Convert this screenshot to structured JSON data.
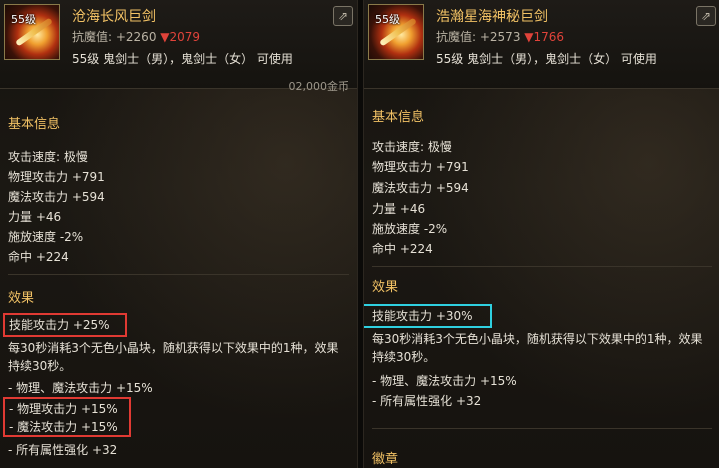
{
  "left_item": {
    "level_badge": "55级",
    "name": "沧海长风巨剑",
    "resist_label": "抗魔值: +2260",
    "resist_delta": "▼2079",
    "classes": "55级 鬼剑士（男），鬼剑士（女） 可使用",
    "price_stub": "02,000金币",
    "basic_info_title": "基本信息",
    "stats": [
      "攻击速度: 极慢",
      "物理攻击力 +791",
      "魔法攻击力 +594",
      "力量 +46",
      "施放速度 -2%",
      "命中 +224"
    ],
    "effects_title": "效果",
    "effect_skill": "技能攻击力 +25%",
    "effect_desc": "每30秒消耗3个无色小晶块，随机获得以下效果中的1种，效果持续30秒。",
    "effect_opt1": "- 物理、魔法攻击力 +15%",
    "effect_opt2": "- 物理攻击力 +15%",
    "effect_opt3": "- 魔法攻击力 +15%",
    "effect_opt4": "- 所有属性强化 +32"
  },
  "right_item": {
    "level_badge": "55级",
    "name": "浩瀚星海神秘巨剑",
    "resist_label": "抗魔值: +2573",
    "resist_delta": "▼1766",
    "classes": "55级 鬼剑士（男），鬼剑士（女） 可使用",
    "basic_info_title": "基本信息",
    "stats": [
      "攻击速度: 极慢",
      "物理攻击力 +791",
      "魔法攻击力 +594",
      "力量 +46",
      "施放速度 -2%",
      "命中 +224"
    ],
    "effects_title": "效果",
    "effect_skill": "技能攻击力 +30%",
    "effect_desc": "每30秒消耗3个无色小晶块，随机获得以下效果中的1种，效果持续30秒。",
    "effect_opt1": "- 物理、魔法攻击力 +15%",
    "effect_opt2": "- 所有属性强化 +32",
    "emblem_title": "徽章"
  },
  "icons": {
    "compare": "compare-icon",
    "weapon": "greatsword-icon"
  },
  "colors": {
    "gold": "#f2c265",
    "red_highlight": "#e03a33",
    "cyan_highlight": "#2fd0e0",
    "down_red": "#e0433a"
  }
}
